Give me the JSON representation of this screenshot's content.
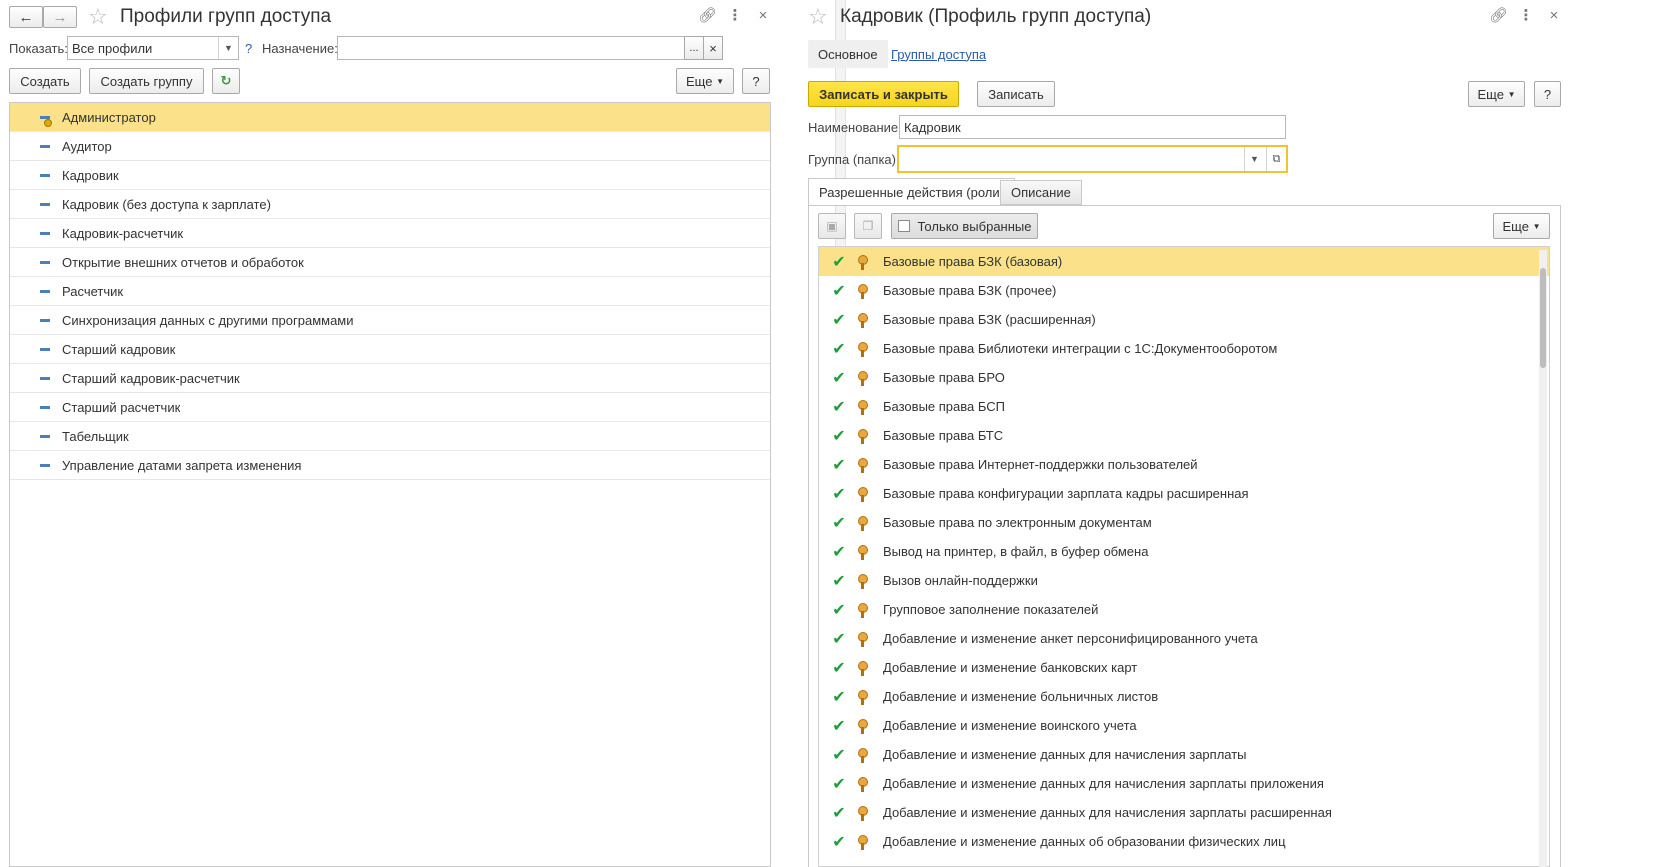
{
  "left": {
    "title": "Профили групп доступа",
    "filter": {
      "show_label": "Показать:",
      "show_value": "Все профили",
      "help": "?",
      "purpose_label": "Назначение:",
      "purpose_value": "",
      "ellipsis": "...",
      "clear": "×"
    },
    "toolbar": {
      "create": "Создать",
      "create_group": "Создать группу",
      "more": "Еще",
      "help": "?"
    },
    "profiles": [
      "Администратор",
      "Аудитор",
      "Кадровик",
      "Кадровик (без доступа к зарплате)",
      "Кадровик-расчетчик",
      "Открытие внешних отчетов и обработок",
      "Расчетчик",
      "Синхронизация данных с другими программами",
      "Старший кадровик",
      "Старший кадровик-расчетчик",
      "Старший расчетчик",
      "Табельщик",
      "Управление датами запрета изменения"
    ],
    "selected_index": 0
  },
  "right": {
    "title": "Кадровик (Профиль групп доступа)",
    "tabs": {
      "main": "Основное",
      "groups": "Группы доступа"
    },
    "toolbar": {
      "save_close": "Записать и закрыть",
      "save": "Записать",
      "more": "Еще",
      "help": "?"
    },
    "name_label": "Наименование:",
    "name_value": "Кадровик",
    "group_label": "Группа (папка):",
    "group_value": "",
    "inner_tabs": {
      "roles": "Разрешенные действия (роли)",
      "description": "Описание"
    },
    "roles_toolbar": {
      "only_selected": "Только выбранные",
      "more": "Еще"
    },
    "roles": [
      "Базовые права БЗК (базовая)",
      "Базовые права БЗК (прочее)",
      "Базовые права БЗК (расширенная)",
      "Базовые права Библиотеки интеграции с 1С:Документооборотом",
      "Базовые права БРО",
      "Базовые права БСП",
      "Базовые права БТС",
      "Базовые права Интернет-поддержки пользователей",
      "Базовые права конфигурации зарплата кадры расширенная",
      "Базовые права по электронным документам",
      "Вывод на принтер, в файл, в буфер обмена",
      "Вызов онлайн-поддержки",
      "Групповое заполнение показателей",
      "Добавление и изменение анкет персонифицированного учета",
      "Добавление и изменение банковских карт",
      "Добавление и изменение больничных листов",
      "Добавление и изменение воинского учета",
      "Добавление и изменение данных для начисления зарплаты",
      "Добавление и изменение данных для начисления зарплаты приложения",
      "Добавление и изменение данных для начисления зарплаты расширенная",
      "Добавление и изменение данных об образовании физических лиц"
    ],
    "selected_index": 0
  }
}
